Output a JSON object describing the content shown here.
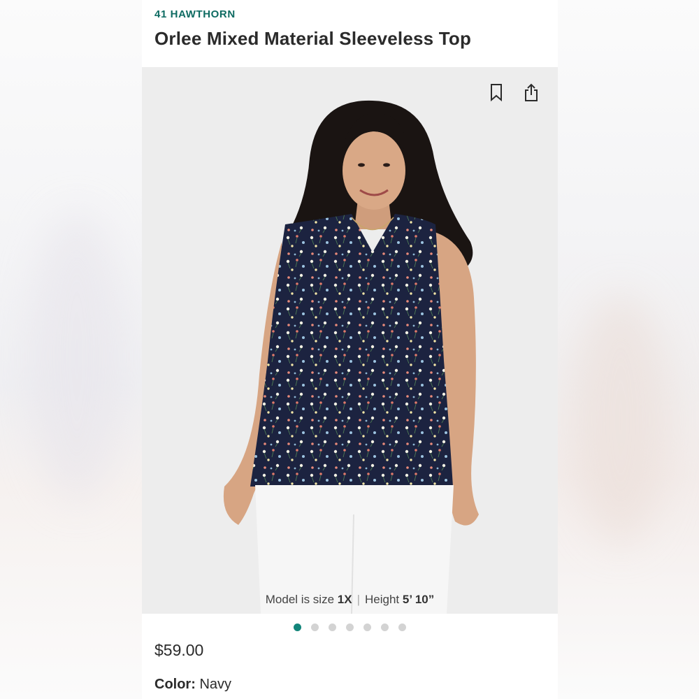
{
  "product": {
    "brand": "41 HAWTHORN",
    "title": "Orlee Mixed Material Sleeveless Top",
    "price": "$59.00",
    "color_label": "Color:",
    "color_value": "Navy"
  },
  "hero": {
    "icons": [
      "bookmark-icon",
      "share-icon"
    ],
    "model_caption": {
      "prefix": "Model is size",
      "size": "1X",
      "separator": "|",
      "height_label": "Height",
      "height_value": "5’ 10”"
    }
  },
  "carousel": {
    "total": 7,
    "active_index": 0
  },
  "colors": {
    "brand": "#0e6b62",
    "active_dot": "#12857a",
    "inactive_dot": "#d3d3d3",
    "hero_bg": "#ededed",
    "top_fabric": "#1c2340",
    "pants": "#f6f6f6"
  }
}
